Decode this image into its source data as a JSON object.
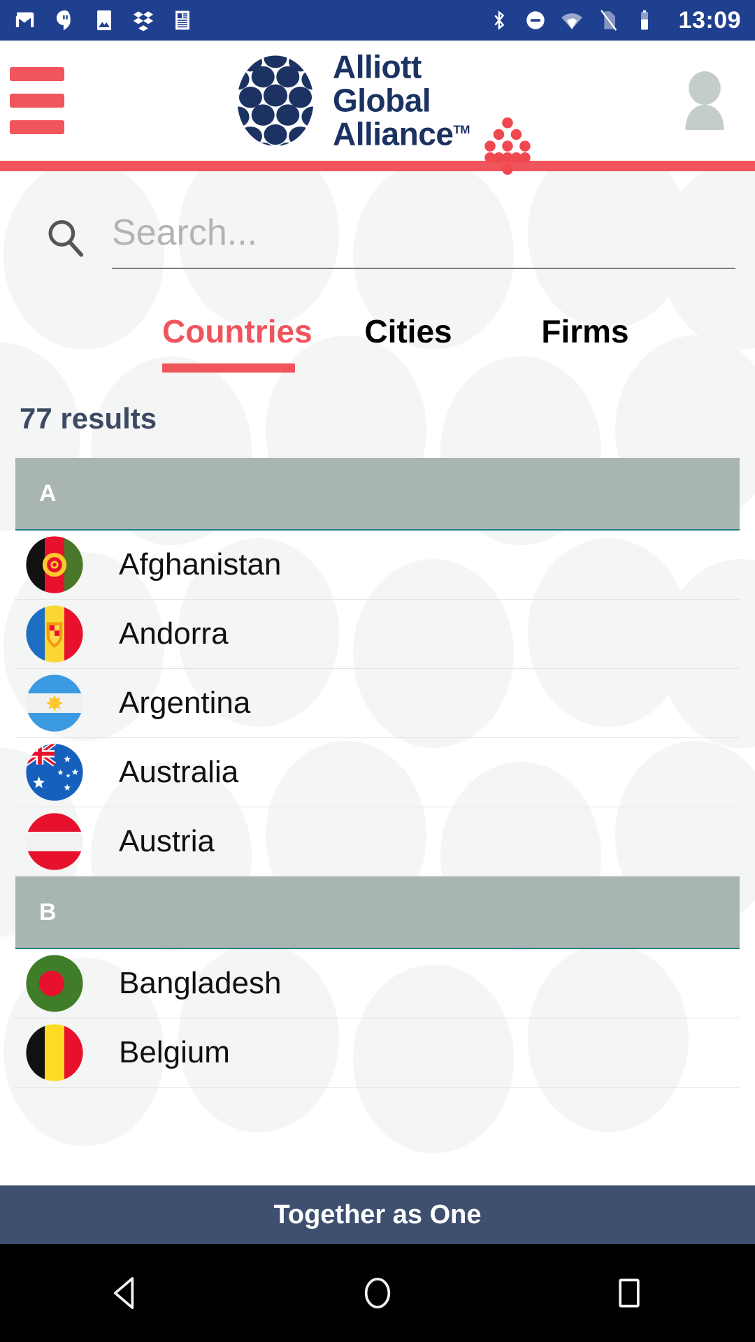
{
  "status_bar": {
    "time": "13:09",
    "left_icons": [
      "gmail-icon",
      "hangouts-icon",
      "photos-icon",
      "dropbox-icon",
      "calculator-icon"
    ],
    "right_icons": [
      "bluetooth-icon",
      "do-not-disturb-icon",
      "wifi-icon",
      "no-sim-icon",
      "battery-icon"
    ],
    "background": "#1f3f8f"
  },
  "header": {
    "menu_icon": "hamburger-menu-icon",
    "brand_line1": "Alliott",
    "brand_line2": "Global",
    "brand_line3": "Alliance",
    "trademark": "TM",
    "brand_color": "#1b3262",
    "accent_color": "#f0545c",
    "secondary_logo": "red-dots-pyramid-logo",
    "avatar": "user-avatar-icon"
  },
  "search": {
    "icon": "search-icon",
    "value": "",
    "placeholder": "Search..."
  },
  "tabs": [
    {
      "label": "Countries",
      "active": true
    },
    {
      "label": "Cities",
      "active": false
    },
    {
      "label": "Firms",
      "active": false
    }
  ],
  "results": {
    "count_label": "77 results"
  },
  "sections": [
    {
      "letter": "A",
      "countries": [
        {
          "name": "Afghanistan",
          "flag": "af"
        },
        {
          "name": "Andorra",
          "flag": "ad"
        },
        {
          "name": "Argentina",
          "flag": "ar"
        },
        {
          "name": "Australia",
          "flag": "au"
        },
        {
          "name": "Austria",
          "flag": "at"
        }
      ]
    },
    {
      "letter": "B",
      "countries": [
        {
          "name": "Bangladesh",
          "flag": "bd"
        },
        {
          "name": "Belgium",
          "flag": "be"
        }
      ]
    }
  ],
  "footer": {
    "tagline": "Together as One",
    "background": "#3e4f70"
  },
  "nav_bar": {
    "back": "back-triangle-icon",
    "home": "home-circle-icon",
    "recents": "recents-square-icon"
  }
}
